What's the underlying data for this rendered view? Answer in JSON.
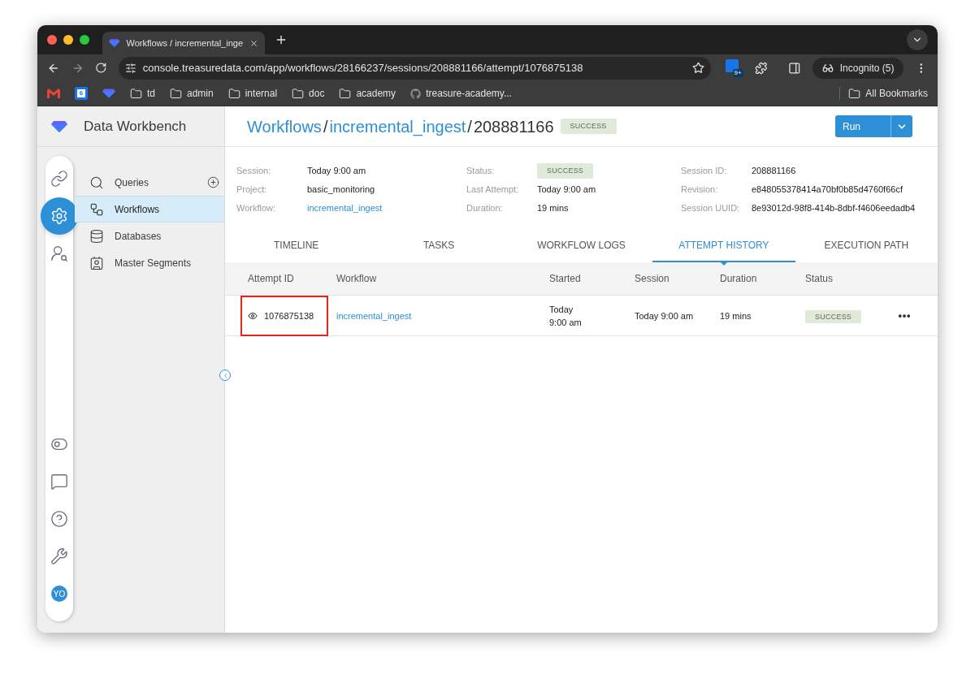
{
  "browser": {
    "tab_title": "Workflows / incremental_inge",
    "url": "console.treasuredata.com/app/workflows/28166237/sessions/208881166/attempt/1076875138",
    "extension_badge": "9+",
    "profile": "Incognito (5)",
    "bookmarks": [
      {
        "kind": "gmail"
      },
      {
        "kind": "calendar",
        "label": "6"
      },
      {
        "kind": "logo"
      },
      {
        "kind": "folder",
        "label": "td"
      },
      {
        "kind": "folder",
        "label": "admin"
      },
      {
        "kind": "folder",
        "label": "internal"
      },
      {
        "kind": "folder",
        "label": "doc"
      },
      {
        "kind": "folder",
        "label": "academy"
      },
      {
        "kind": "github",
        "label": "treasure-academy..."
      }
    ],
    "all_bookmarks": "All Bookmarks"
  },
  "app": {
    "title": "Data Workbench"
  },
  "rail": {
    "items": [
      {
        "kind": "link",
        "selected": false
      },
      {
        "kind": "workflow",
        "selected": true
      },
      {
        "kind": "audience",
        "selected": false
      },
      {
        "kind": "toggles",
        "selected": false
      },
      {
        "kind": "contact",
        "selected": false
      },
      {
        "kind": "help",
        "selected": false
      },
      {
        "kind": "tools",
        "selected": false
      },
      {
        "kind": "avatar",
        "label": "YO",
        "selected": false
      }
    ]
  },
  "nav": {
    "items": [
      {
        "kind": "queries",
        "label": "Queries",
        "selected": false,
        "addable": true
      },
      {
        "kind": "workflows",
        "label": "Workflows",
        "selected": true,
        "addable": false
      },
      {
        "kind": "databases",
        "label": "Databases",
        "selected": false,
        "addable": false
      },
      {
        "kind": "segments",
        "label": "Master Segments",
        "selected": false,
        "addable": false
      }
    ]
  },
  "header": {
    "breadcrumbs": [
      "Workflows",
      "incremental_ingest"
    ],
    "separator": "/",
    "current": "208881166",
    "status": "SUCCESS",
    "run_button": "Run"
  },
  "details": [
    [
      {
        "label": "Session:",
        "value": "Today 9:00 am",
        "kind": "text"
      },
      {
        "label": "Project:",
        "value": "basic_monitoring",
        "kind": "text"
      },
      {
        "label": "Workflow:",
        "value": "incremental_ingest",
        "kind": "link"
      }
    ],
    [
      {
        "label": "Status:",
        "value": "SUCCESS",
        "kind": "badge"
      },
      {
        "label": "Last Attempt:",
        "value": "Today 9:00 am",
        "kind": "text"
      },
      {
        "label": "Duration:",
        "value": "19 mins",
        "kind": "text"
      }
    ],
    [
      {
        "label": "Session ID:",
        "value": "208881166",
        "kind": "text"
      },
      {
        "label": "Revision:",
        "value": "e848055378414a70bf0b85d4760f66cf",
        "kind": "text"
      },
      {
        "label": "Session UUID:",
        "value": "8e93012d-98f8-414b-8dbf-f4606eedadb4",
        "kind": "text"
      }
    ]
  ],
  "tabs": [
    {
      "label": "TIMELINE",
      "selected": false
    },
    {
      "label": "TASKS",
      "selected": false
    },
    {
      "label": "WORKFLOW LOGS",
      "selected": false
    },
    {
      "label": "ATTEMPT HISTORY",
      "selected": true
    },
    {
      "label": "EXECUTION PATH",
      "selected": false
    }
  ],
  "table": {
    "columns": [
      "Attempt ID",
      "Workflow",
      "Started",
      "Session",
      "Duration",
      "Status"
    ],
    "rows": [
      {
        "attempt_id": "1076875138",
        "highlighted": true,
        "workflow": "incremental_ingest",
        "started": [
          "Today",
          "9:00 am"
        ],
        "session": "Today 9:00 am",
        "duration": "19 mins",
        "status": "SUCCESS"
      }
    ]
  }
}
